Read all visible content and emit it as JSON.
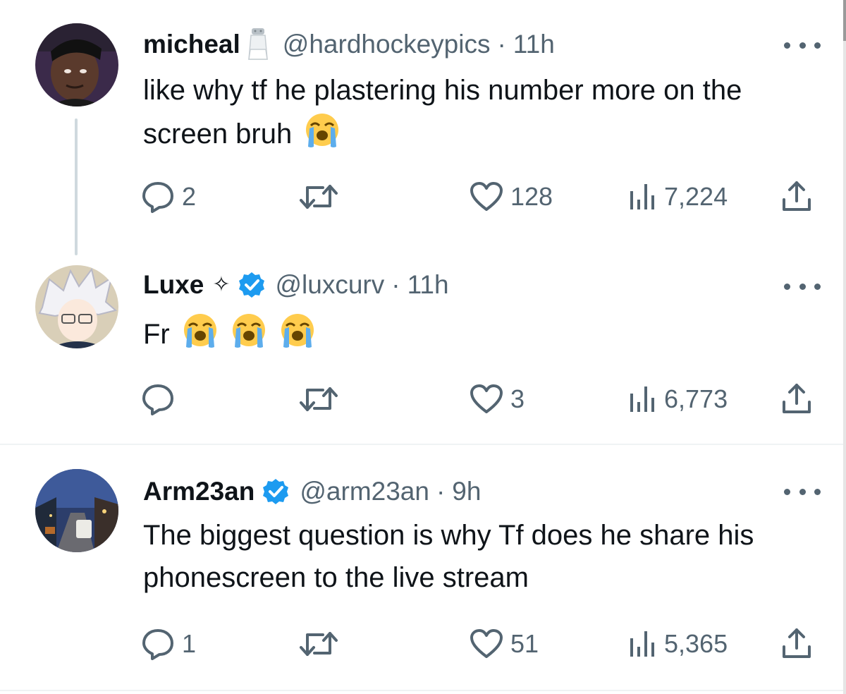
{
  "tweets": [
    {
      "name": "micheal",
      "name_emoji": "salt-shaker-icon",
      "verified": false,
      "handle": "@hardhockeypics",
      "dot": "·",
      "time": "11h",
      "text": "like why tf he plastering his number more on the screen bruh",
      "emojis": [
        "loudly-crying-face-icon"
      ],
      "replies": "2",
      "retweets": "",
      "likes": "128",
      "views": "7,224"
    },
    {
      "name": "Luxe",
      "name_suffix": "✧",
      "verified": true,
      "handle": "@luxcurv",
      "dot": "·",
      "time": "11h",
      "text": "Fr",
      "emojis": [
        "loudly-crying-face-icon",
        "loudly-crying-face-icon",
        "loudly-crying-face-icon"
      ],
      "replies": "",
      "retweets": "",
      "likes": "3",
      "views": "6,773"
    },
    {
      "name": "Arm23an",
      "verified": true,
      "handle": "@arm23an",
      "dot": "·",
      "time": "9h",
      "text": "The biggest question is why Tf does he share his phonescreen to the live stream",
      "emojis": [],
      "replies": "1",
      "retweets": "",
      "likes": "51",
      "views": "5,365"
    }
  ],
  "colors": {
    "text": "#0f1419",
    "secondary": "#536471",
    "verified_blue": "#1d9bf0",
    "thread_line": "#cfd9de",
    "divider": "#eff3f4"
  }
}
